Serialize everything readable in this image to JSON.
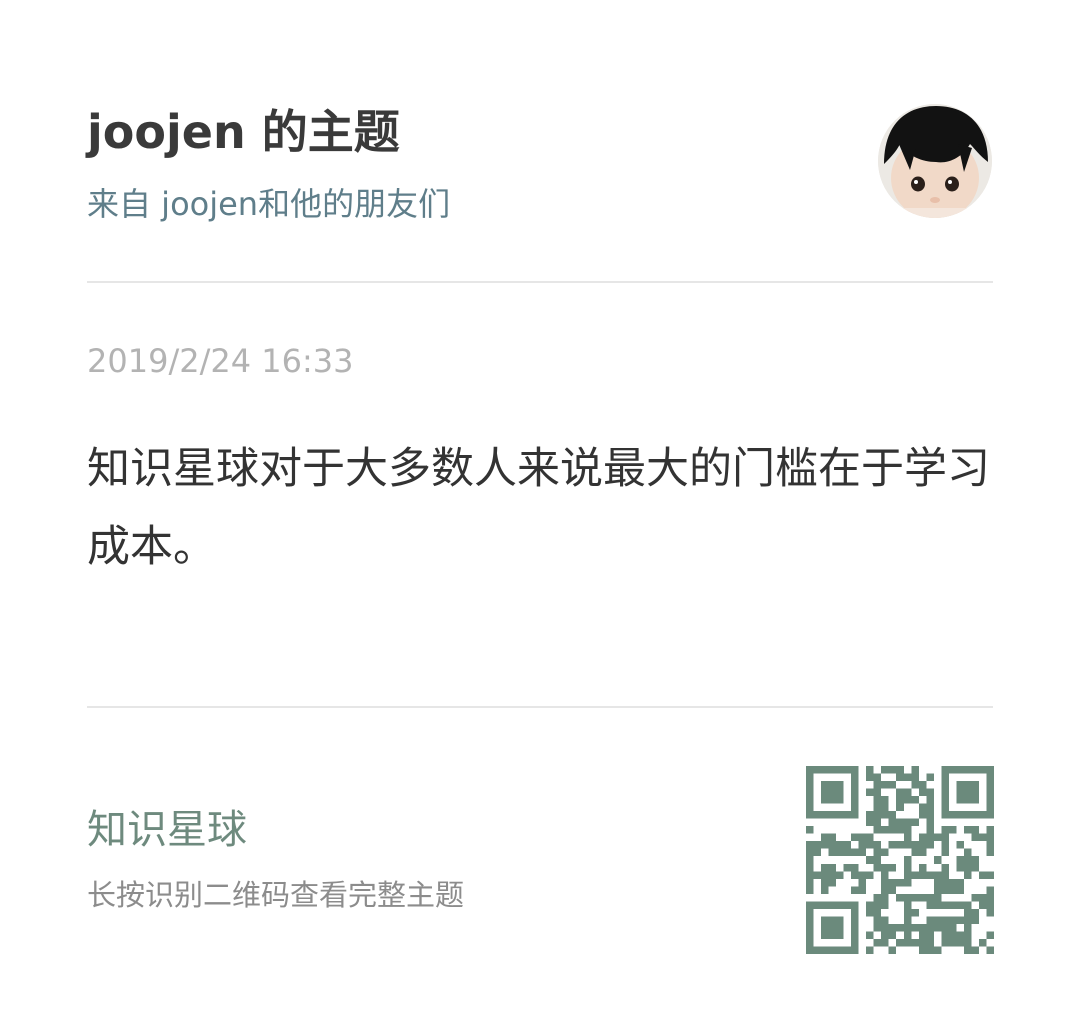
{
  "header": {
    "title": "joojen 的主题",
    "subtitle": "来自 joojen和他的朋友们"
  },
  "post": {
    "timestamp": "2019/2/24 16:33",
    "content": "知识星球对于大多数人来说最大的门槛在于学习成本。"
  },
  "footer": {
    "brand": "知识星球",
    "hint": "长按识别二维码查看完整主题"
  },
  "colors": {
    "title": "#3a3a3a",
    "subtitle": "#5f7e8a",
    "timestamp": "#b3b3b3",
    "content": "#333333",
    "brand": "#6e8a7e",
    "hint": "#8c8c8c",
    "qr": "#6b8a7c",
    "divider": "#e6e6e6"
  },
  "icons": {
    "avatar": "avatar-photo",
    "qr": "qr-code-icon"
  }
}
